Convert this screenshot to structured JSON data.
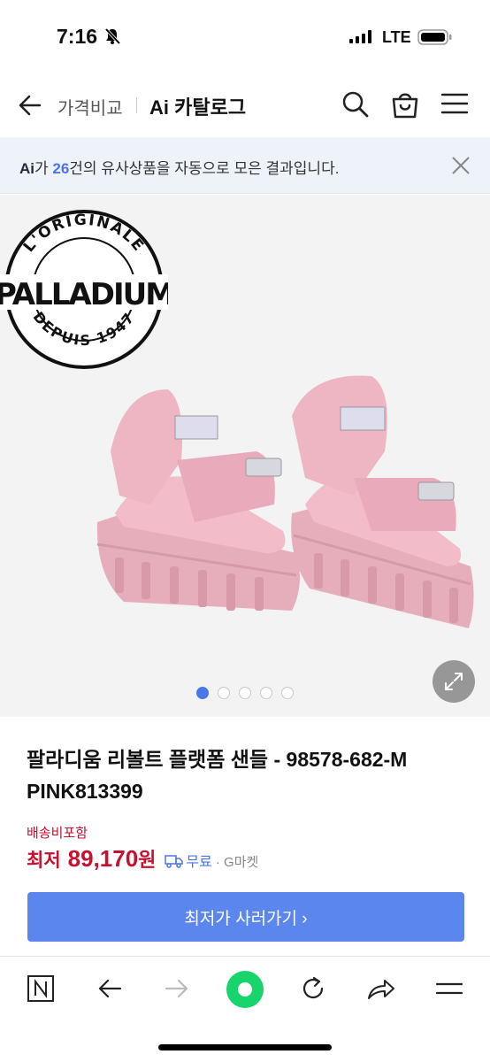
{
  "status_bar": {
    "time": "7:16",
    "network": "LTE"
  },
  "nav": {
    "breadcrumb": "가격비교",
    "title": "Ai 카탈로그"
  },
  "banner": {
    "ai_mark": "Ai",
    "prefix": "가 ",
    "count": "26",
    "suffix": "건의 유사상품을 자동으로 모은 결과입니다."
  },
  "product": {
    "brand_logo_text_top": "L'ORIGINALE",
    "brand_logo_text_main": "PALLADIUM",
    "brand_logo_text_bottom": "DEPUIS 1947",
    "title": "팔라디움 리볼트 플랫폼 샌들 - 98578-682-M PINK813399",
    "shipping_label": "배송비포함",
    "price_label": "최저",
    "price": "89,170",
    "price_unit": "원",
    "free_shipping": "무료",
    "seller": "· G마켓",
    "buy_button": "최저가 사러가기 ›",
    "image_count": 5,
    "active_image": 1
  },
  "colors": {
    "accent": "#4a76e8",
    "price": "#c8102e",
    "button": "#5b86ee",
    "banner_bg": "#eef3f9"
  },
  "toolbar": {
    "items": [
      "n-icon",
      "back-icon",
      "forward-icon",
      "home-dot-icon",
      "refresh-icon",
      "share-icon",
      "menu-icon"
    ]
  }
}
